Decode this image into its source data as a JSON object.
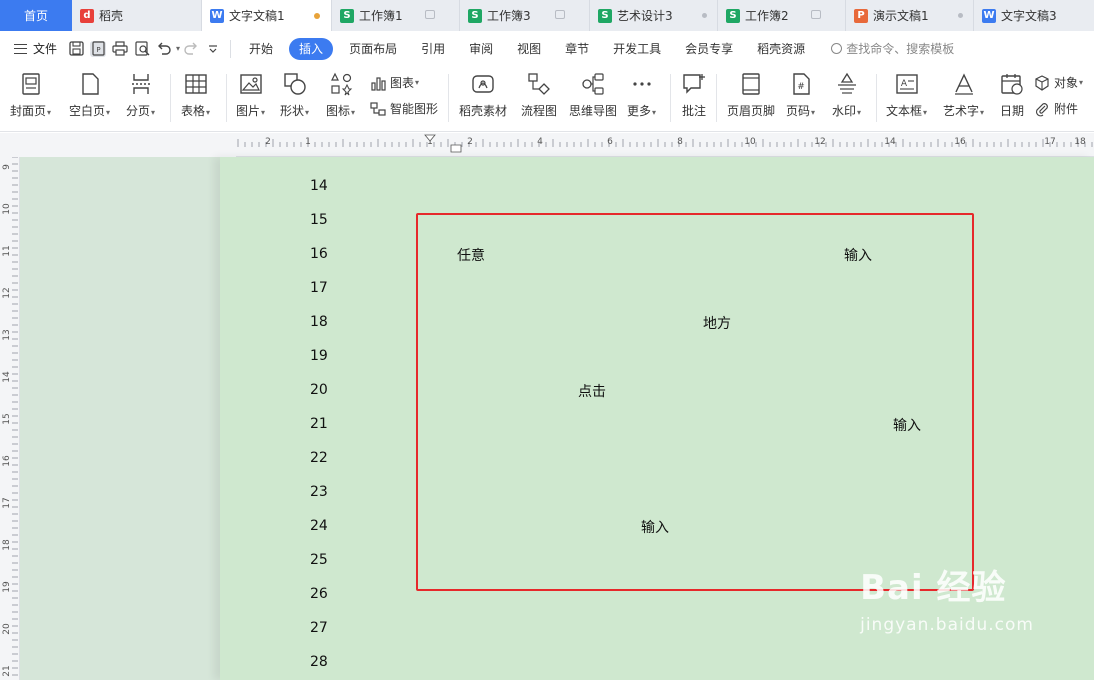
{
  "tabs": [
    {
      "label": "首页",
      "kind": "home"
    },
    {
      "label": "稻壳",
      "kind": "daoke"
    },
    {
      "label": "文字文稿1",
      "kind": "writer",
      "active": true
    },
    {
      "label": "工作簿1",
      "kind": "sheet"
    },
    {
      "label": "工作簿3",
      "kind": "sheet"
    },
    {
      "label": "艺术设计3",
      "kind": "sheet"
    },
    {
      "label": "工作簿2",
      "kind": "sheet"
    },
    {
      "label": "演示文稿1",
      "kind": "ppt"
    },
    {
      "label": "文字文稿3",
      "kind": "writer"
    }
  ],
  "menubar": {
    "file_label": "文件",
    "items": [
      "开始",
      "插入",
      "页面布局",
      "引用",
      "审阅",
      "视图",
      "章节",
      "开发工具",
      "会员专享",
      "稻壳资源"
    ],
    "active_item": "插入",
    "search_placeholder": "查找命令、搜索模板"
  },
  "ribbon": {
    "cover_page": "封面页",
    "blank_page": "空白页",
    "page_break": "分页",
    "table": "表格",
    "picture": "图片",
    "shape": "形状",
    "icon": "图标",
    "chart": "图表",
    "smart_art": "智能图形",
    "daoke_material": "稻壳素材",
    "flowchart": "流程图",
    "mindmap": "思维导图",
    "more": "更多",
    "comment": "批注",
    "header_footer": "页眉页脚",
    "page_number": "页码",
    "watermark": "水印",
    "textbox": "文本框",
    "word_art": "艺术字",
    "date": "日期",
    "object": "对象",
    "attachment": "附件"
  },
  "ruler_h_labels": [
    "2",
    "1",
    "1",
    "2",
    "4",
    "6",
    "8",
    "10",
    "12",
    "14",
    "16",
    "17",
    "18"
  ],
  "ruler_v_labels": [
    "9",
    "10",
    "11",
    "12",
    "13",
    "14",
    "15",
    "16",
    "17",
    "18",
    "19",
    "20",
    "21"
  ],
  "line_numbers": [
    "14",
    "15",
    "16",
    "17",
    "18",
    "19",
    "20",
    "21",
    "22",
    "23",
    "24",
    "25",
    "26",
    "27",
    "28"
  ],
  "doc_texts": {
    "t1": "任意",
    "t2": "输入",
    "t3": "地方",
    "t4": "点击",
    "t5": "输入",
    "t6": "输入"
  },
  "watermark": {
    "brand": "Bai 经验",
    "url": "jingyan.baidu.com"
  },
  "colors": {
    "accent": "#3c7bf0",
    "page_bg": "#cfe8cf",
    "selection": "#e6282b"
  }
}
